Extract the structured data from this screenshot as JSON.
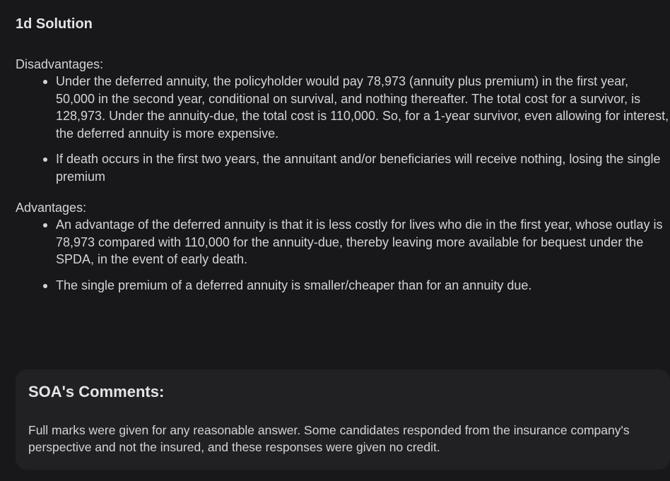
{
  "solution": {
    "title": "1d Solution",
    "disadvantages_label": "Disadvantages:",
    "disadvantages": [
      "Under the deferred annuity, the policyholder would pay 78,973 (annuity plus premium) in the first year, 50,000 in the second year, conditional on survival, and nothing thereafter. The total cost for a survivor, is 128,973. Under the annuity-due, the total cost is 110,000. So, for a 1-year survivor, even allowing for interest, the deferred annuity is more expensive.",
      "If death occurs in the first two years, the annuitant and/or beneficiaries will receive nothing, losing the single premium"
    ],
    "advantages_label": "Advantages:",
    "advantages": [
      "An advantage of the deferred annuity is that it is less costly for lives who die in the first year, whose outlay is 78,973 compared with 110,000 for the annuity-due, thereby leaving more available for bequest under the SPDA, in the event of early death.",
      "The single premium of a deferred annuity is smaller/cheaper than for an annuity due."
    ]
  },
  "comments": {
    "title": "SOA's Comments:",
    "text": "Full marks were given for any reasonable answer. Some candidates responded from the insurance company's perspective and not the insured, and these responses were given no credit."
  }
}
